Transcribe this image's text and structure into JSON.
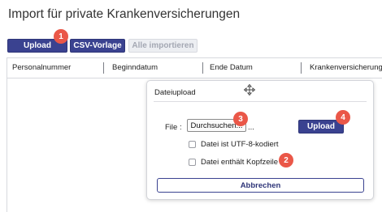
{
  "page": {
    "title": "Import für private Krankenversicherungen"
  },
  "toolbar": {
    "upload_label": "Upload",
    "csv_label": "CSV-Vorlage",
    "import_all_label": "Alle importieren"
  },
  "table": {
    "columns": [
      "Personalnummer",
      "Beginndatum",
      "Ende Datum",
      "Krankenversicherung"
    ]
  },
  "dialog": {
    "title": "Dateiupload",
    "file_label": "File :",
    "browse_label": "Durchsuchen...",
    "file_name": "...",
    "upload_label": "Upload",
    "utf8_label": "Datei ist UTF-8-kodiert",
    "utf8_checked": false,
    "header_label": "Datei enthält Kopfzeile",
    "header_checked": false,
    "cancel_label": "Abbrechen"
  },
  "badges": {
    "b1": "1",
    "b2": "2",
    "b3": "3",
    "b4": "4"
  },
  "colors": {
    "primary": "#3a4290",
    "badge": "#ea5748",
    "disabled_bg": "#eceef2"
  },
  "icons": {
    "dialog_handle": "move-arrows-icon"
  }
}
